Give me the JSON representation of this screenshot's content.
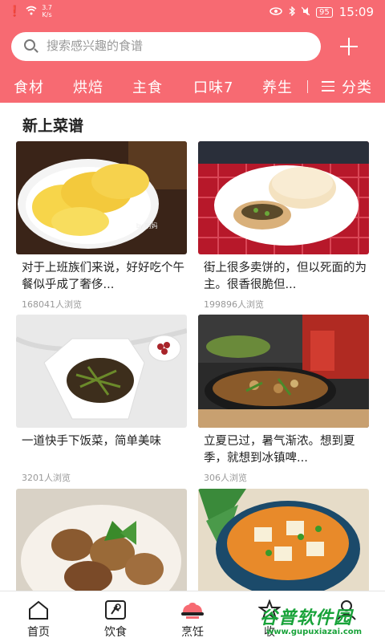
{
  "status_bar": {
    "net_speed": "3.7",
    "net_unit": "K/s",
    "battery": "95",
    "time": "15:09"
  },
  "search": {
    "placeholder": "搜索感兴趣的食谱"
  },
  "categories": [
    "食材",
    "烘焙",
    "主食",
    "口味7",
    "养生",
    "分类"
  ],
  "section_title": "新上菜谱",
  "recipes": [
    {
      "title": "对于上班族们来说，好好吃个午餐似乎成了奢侈...",
      "views": "168041人浏览",
      "watermark": "by 萌妈"
    },
    {
      "title": "街上很多卖饼的，但以死面的为主。很香很脆但...",
      "views": "199896人浏览"
    },
    {
      "title": "一道快手下饭菜，简单美味",
      "views": "3201人浏览"
    },
    {
      "title": "立夏已过，暑气渐浓。想到夏季，就想到冰镇啤...",
      "views": "306人浏览"
    },
    {
      "title": "",
      "views": ""
    },
    {
      "title": "",
      "views": ""
    }
  ],
  "tabs": [
    "首页",
    "饮食",
    "烹饪",
    "收"
  ],
  "watermark": {
    "text": "谷普软件园",
    "url": "www.gupuxiazai.com"
  },
  "colors": {
    "brand": "#f76a72",
    "watermark": "#19a33a"
  }
}
